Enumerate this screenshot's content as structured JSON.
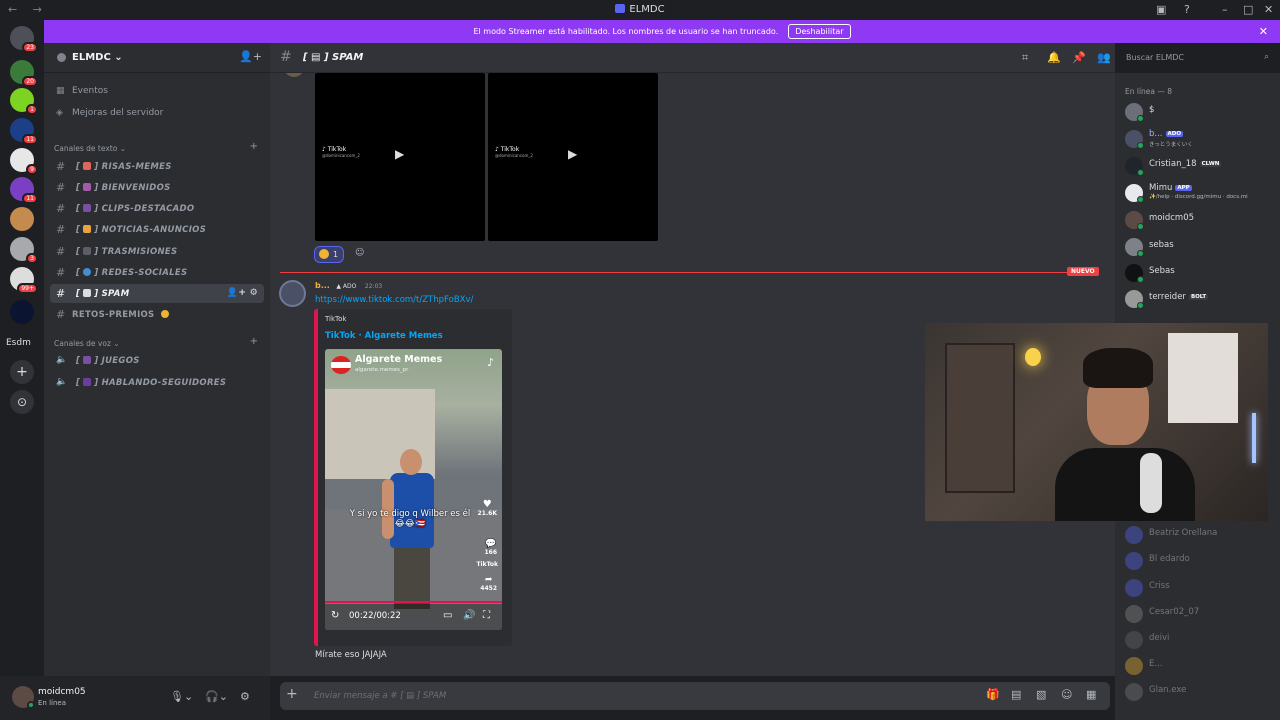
{
  "window": {
    "title": "ELMDC",
    "nav": "← →"
  },
  "banner": {
    "text": "El modo Streamer está habilitado. Los nombres de usuario se han truncado.",
    "button": "Deshabilitar"
  },
  "guilds": {
    "badges": [
      "23",
      "20",
      "1",
      "11",
      "9",
      "11",
      "3",
      "99+"
    ],
    "label": "Esdm"
  },
  "server": {
    "name": "ELMDC ⌄",
    "items": [
      {
        "label": "Eventos",
        "icon": "calendar-icon"
      },
      {
        "label": "Mejoras del servidor",
        "icon": "boost-icon"
      }
    ],
    "text_category": "Canales de texto ⌄",
    "text_channels": [
      "RISAS-MEMES",
      "BIENVENIDOS",
      "CLIPS-DESTACADO",
      "NOTICIAS-ANUNCIOS",
      "TRASMISIONES",
      "REDES-SOCIALES",
      "SPAM",
      "RETOS-PREMIOS"
    ],
    "voice_category": "Canales de voz ⌄",
    "voice_channels": [
      "JUEGOS",
      "HABLANDO-SEGUIDORES"
    ],
    "colors": {
      "risas": "#e0655a",
      "bienvenidos": "#a25ba8",
      "clips": "#7b4fa3",
      "noticias": "#e8a33d",
      "trasmisiones": "#5b5e66",
      "redes": "#3f8fd2",
      "spam": "#dbdee1",
      "juegos": "#7b4fa3",
      "hablando": "#6a3ea1"
    }
  },
  "user": {
    "name": "moidcm05",
    "status": "En línea"
  },
  "channel": {
    "name": "SPAM",
    "composer_placeholder": "Enviar mensaje a #",
    "composer_channel": "SPAM"
  },
  "search": {
    "placeholder": "Buscar ELMDC"
  },
  "messages": {
    "videos": [
      {
        "brand": "TikTok",
        "handle": "@dominicancom_2"
      },
      {
        "brand": "TikTok",
        "handle": "@dominicancom_2"
      }
    ],
    "reaction_count": "1",
    "new_label": "NUEVO",
    "author": "b...",
    "author_tag": "ADO",
    "time": "22:03",
    "link": "https://www.tiktok.com/t/ZThpFoBXv/",
    "embed": {
      "provider": "TikTok",
      "title": "TikTok · Algarete Memes",
      "video_channel": "Algarete Memes",
      "video_handle": "algarete.memes_pr",
      "caption": "Y si yo te digo q Wilber es él 😂😂🇵🇷",
      "likes": "21.6K",
      "comments": "166",
      "shares": "4452",
      "watermark": "TikTok",
      "time": "00:22/00:22"
    },
    "text": "Mírate eso JAJAJA"
  },
  "members": {
    "online_header": "En línea — 8",
    "online": [
      {
        "name": "$",
        "sub": "",
        "tag": "",
        "color": "#6b6f78"
      },
      {
        "name": "b...",
        "sub": "きっとうまくいく",
        "tag": "ADO",
        "color": "#4a5065"
      },
      {
        "name": "Cristian_18",
        "sub": "",
        "tag": "CLWN",
        "color": "#20252b"
      },
      {
        "name": "Mimu",
        "sub": "✨/help · discord.gg/mimu · docs.mi",
        "tag": "APP",
        "color": "#e8e8ee"
      },
      {
        "name": "moidcm05",
        "sub": "",
        "tag": "",
        "color": "#5b4b44"
      },
      {
        "name": "sebas",
        "sub": "",
        "tag": "",
        "color": "#7e8288"
      },
      {
        "name": "Sebas",
        "sub": "",
        "tag": "",
        "color": "#111"
      },
      {
        "name": "terreider",
        "sub": "",
        "tag": "BOLT",
        "color": "#999"
      }
    ],
    "offline": [
      "Beatriz Orellana",
      "Bl edardo",
      "Criss",
      "Cesar02_07",
      "deivi",
      "E...",
      "Glan.exe"
    ]
  }
}
